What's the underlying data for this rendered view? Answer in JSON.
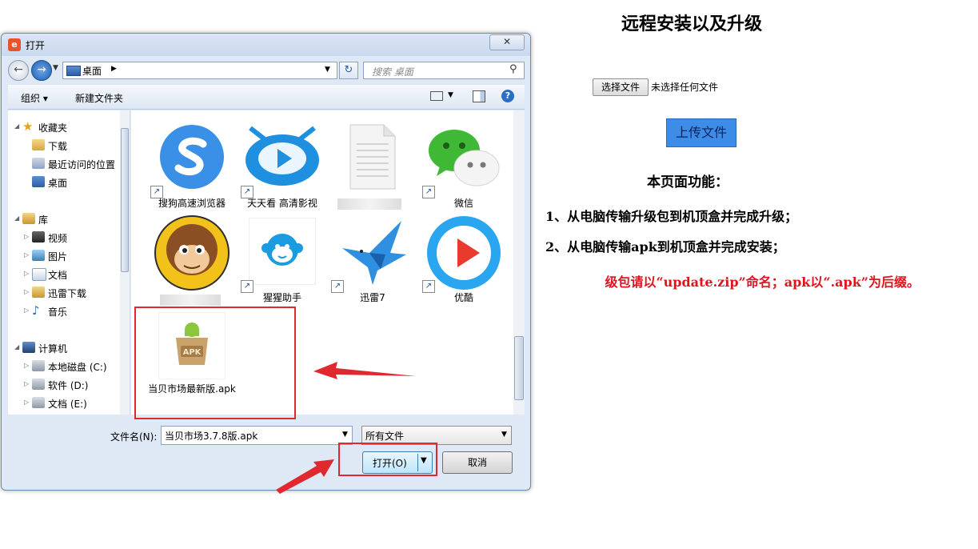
{
  "page": {
    "title": "远程安装以及升级",
    "choose_file_button": "选择文件",
    "no_file_text": "未选择任何文件",
    "upload_button": "上传文件",
    "functions_title": "本页面功能：",
    "function_1": "1、从电脑传输升级包到机顶盒并完成升级；",
    "function_2": "2、从电脑传输apk到机顶盒并完成安装；",
    "notice": "级包请以“update.zip”命名；apk以“.apk”为后缀。"
  },
  "dialog": {
    "title": "打开",
    "close": "✕",
    "address": "桌面",
    "search_placeholder": "搜索 桌面",
    "toolbar": {
      "organize": "组织 ▾",
      "new_folder": "新建文件夹"
    },
    "nav_tree": [
      {
        "label": "收藏夹",
        "icon": "star-icon",
        "level": 0,
        "expanded": true
      },
      {
        "label": "下载",
        "icon": "downloads-folder-icon",
        "level": 1
      },
      {
        "label": "最近访问的位置",
        "icon": "recent-places-icon",
        "level": 1
      },
      {
        "label": "桌面",
        "icon": "desktop-icon",
        "level": 1
      },
      {
        "label": "库",
        "icon": "libraries-icon",
        "level": 0,
        "expanded": true
      },
      {
        "label": "视频",
        "icon": "video-library-icon",
        "level": 1
      },
      {
        "label": "图片",
        "icon": "pictures-library-icon",
        "level": 1
      },
      {
        "label": "文档",
        "icon": "documents-library-icon",
        "level": 1
      },
      {
        "label": "迅雷下载",
        "icon": "thunder-download-icon",
        "level": 1
      },
      {
        "label": "音乐",
        "icon": "music-library-icon",
        "level": 1
      },
      {
        "label": "计算机",
        "icon": "computer-icon",
        "level": 0,
        "expanded": true
      },
      {
        "label": "本地磁盘 (C:)",
        "icon": "local-disk-icon",
        "level": 1
      },
      {
        "label": "软件 (D:)",
        "icon": "drive-icon",
        "level": 1
      },
      {
        "label": "文档 (E:)",
        "icon": "drive-icon",
        "level": 1
      }
    ],
    "files": [
      {
        "label": "搜狗高速浏览器",
        "icon": "sogou-browser-icon"
      },
      {
        "label": "天天看 高清影视",
        "icon": "tiantiankan-player-icon"
      },
      {
        "label": "",
        "icon": "document-file-icon"
      },
      {
        "label": "微信",
        "icon": "wechat-icon"
      },
      {
        "label": "",
        "icon": "monkey-avatar-icon"
      },
      {
        "label": "猩猩助手",
        "icon": "xingxing-assistant-icon"
      },
      {
        "label": "迅雷7",
        "icon": "thunder-bird-icon"
      },
      {
        "label": "优酷",
        "icon": "youku-icon"
      },
      {
        "label": "当贝市场最新版.apk",
        "icon": "apk-box-icon",
        "apk_badge": "APK"
      }
    ],
    "filename_label": "文件名(N):",
    "filename_value": "当贝市场3.7.8版.apk",
    "filetype_value": "所有文件",
    "open_button": "打开(O)",
    "cancel_button": "取消"
  },
  "colors": {
    "highlight": "#e0292f",
    "upload_button_bg": "#3d8de8",
    "notice": "#e0141e"
  }
}
